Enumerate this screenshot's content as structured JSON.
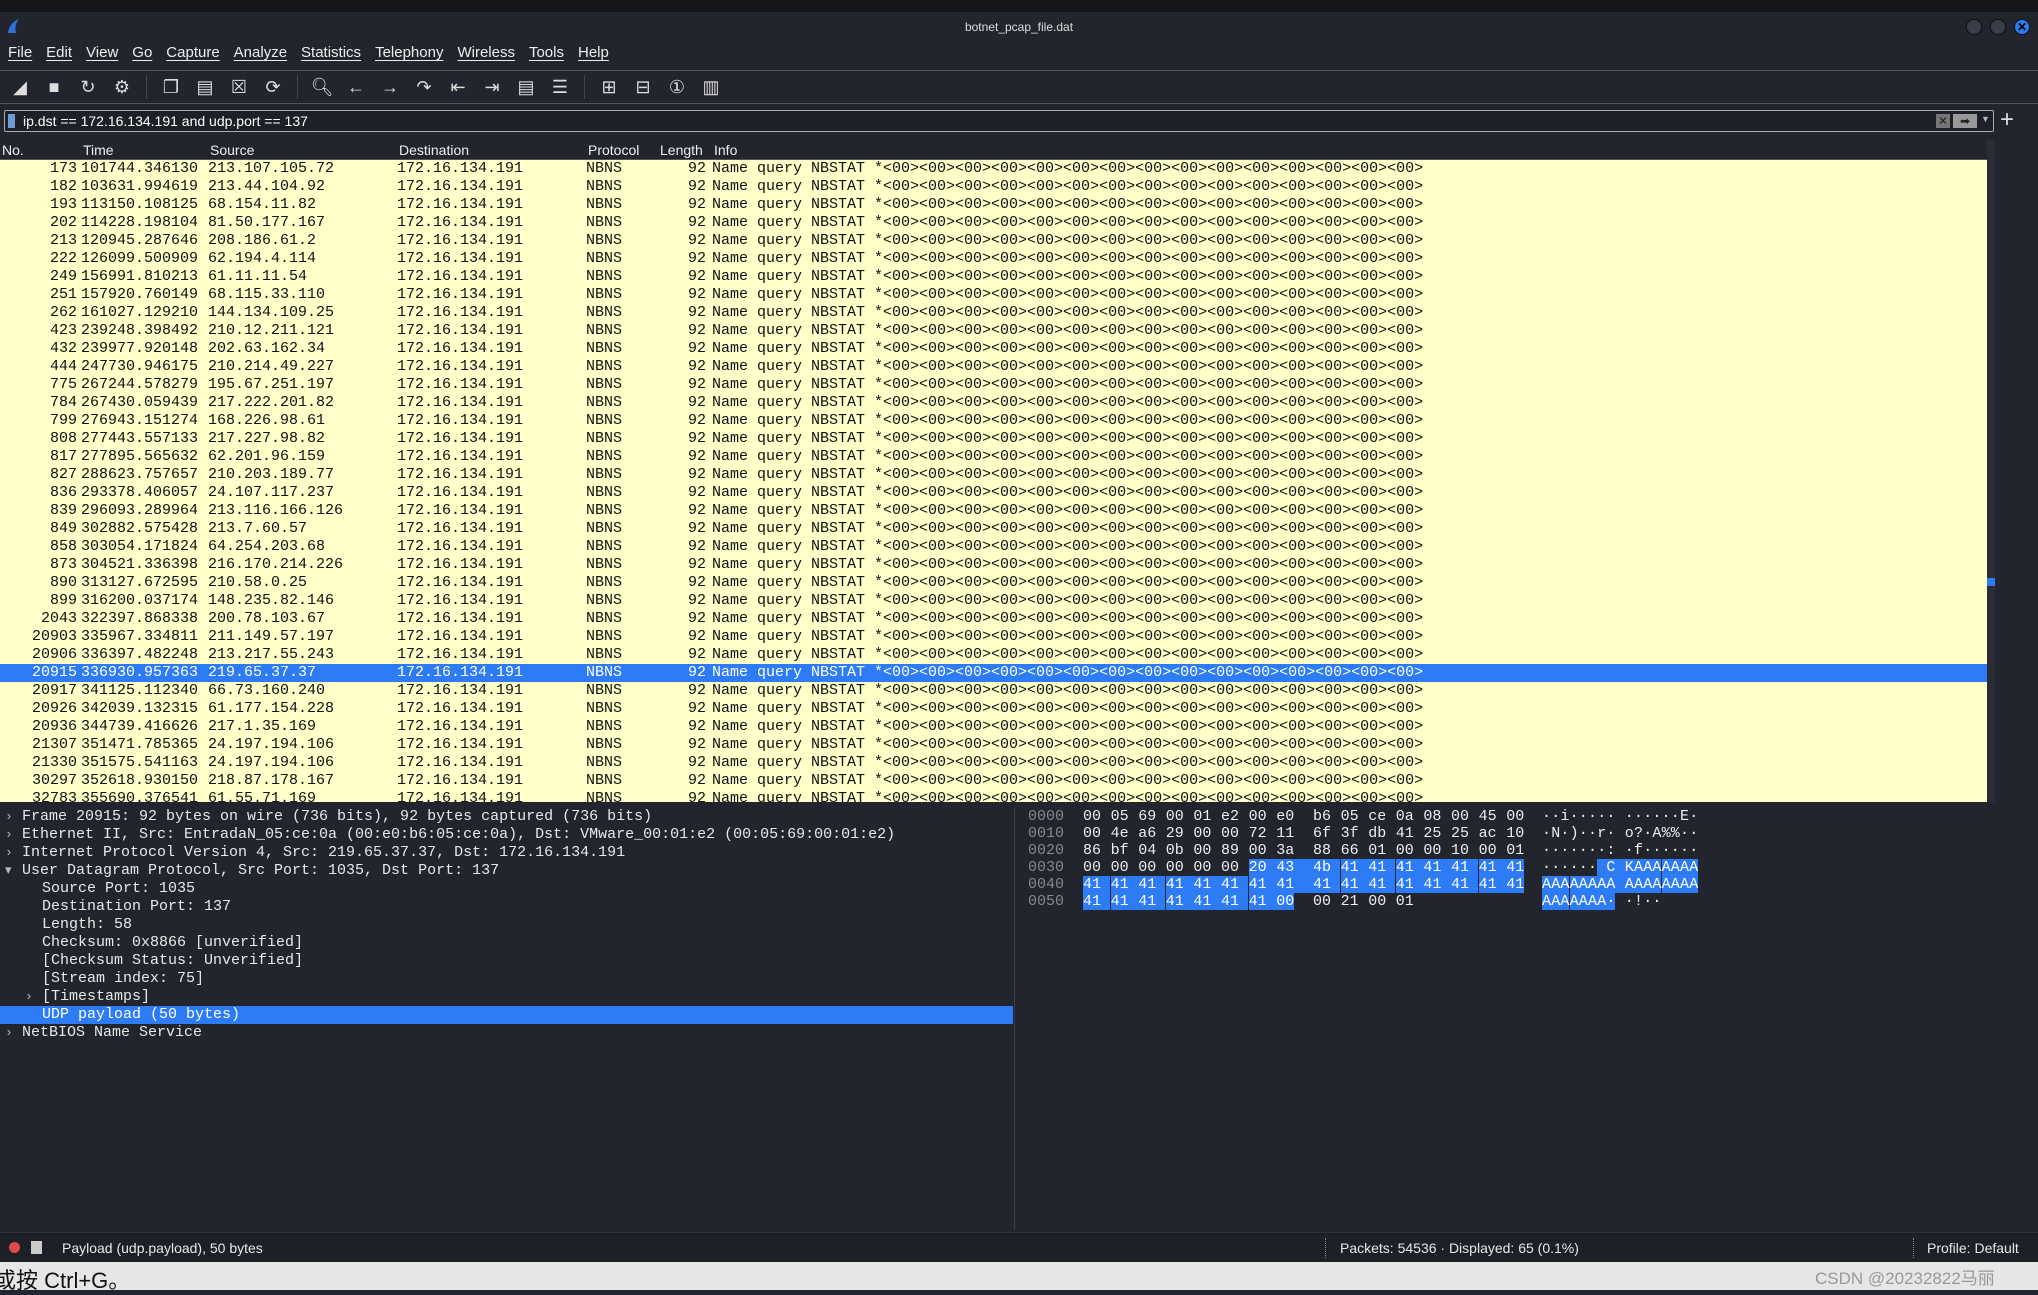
{
  "window": {
    "title": "botnet_pcap_file.dat"
  },
  "menu": [
    "File",
    "Edit",
    "View",
    "Go",
    "Capture",
    "Analyze",
    "Statistics",
    "Telephony",
    "Wireless",
    "Tools",
    "Help"
  ],
  "toolbar": [
    "shark-fin-start-icon",
    "stop-square-icon",
    "restart-fin-icon",
    "gear-options-icon",
    "open-file-icon",
    "save-file-icon",
    "close-file-icon",
    "reload-file-icon",
    "search-icon",
    "arrow-left-icon",
    "arrow-right-icon",
    "jump-icon",
    "first-packet-icon",
    "last-packet-icon",
    "autoscroll-icon",
    "colorize-icon",
    "zoom-in-icon",
    "zoom-out-icon",
    "normal-size-icon",
    "resize-columns-icon"
  ],
  "filter": {
    "value": "ip.dst == 172.16.134.191 and udp.port == 137"
  },
  "columns": [
    "No.",
    "Time",
    "Source",
    "Destination",
    "Protocol",
    "Length",
    "Info"
  ],
  "colors": {
    "list_bg": "#feffc9",
    "selected": "#2d7bf5",
    "background": "#23252e"
  },
  "packets": [
    [
      "173",
      "101744.346130",
      "213.107.105.72"
    ],
    [
      "182",
      "103631.994619",
      "213.44.104.92"
    ],
    [
      "193",
      "113150.108125",
      "68.154.11.82"
    ],
    [
      "202",
      "114228.198104",
      "81.50.177.167"
    ],
    [
      "213",
      "120945.287646",
      "208.186.61.2"
    ],
    [
      "222",
      "126099.500909",
      "62.194.4.114"
    ],
    [
      "249",
      "156991.810213",
      "61.11.11.54"
    ],
    [
      "251",
      "157920.760149",
      "68.115.33.110"
    ],
    [
      "262",
      "161027.129210",
      "144.134.109.25"
    ],
    [
      "423",
      "239248.398492",
      "210.12.211.121"
    ],
    [
      "432",
      "239977.920148",
      "202.63.162.34"
    ],
    [
      "444",
      "247730.946175",
      "210.214.49.227"
    ],
    [
      "775",
      "267244.578279",
      "195.67.251.197"
    ],
    [
      "784",
      "267430.059439",
      "217.222.201.82"
    ],
    [
      "799",
      "276943.151274",
      "168.226.98.61"
    ],
    [
      "808",
      "277443.557133",
      "217.227.98.82"
    ],
    [
      "817",
      "277895.565632",
      "62.201.96.159"
    ],
    [
      "827",
      "288623.757657",
      "210.203.189.77"
    ],
    [
      "836",
      "293378.406057",
      "24.107.117.237"
    ],
    [
      "839",
      "296093.289964",
      "213.116.166.126"
    ],
    [
      "849",
      "302882.575428",
      "213.7.60.57"
    ],
    [
      "858",
      "303054.171824",
      "64.254.203.68"
    ],
    [
      "873",
      "304521.336398",
      "216.170.214.226"
    ],
    [
      "890",
      "313127.672595",
      "210.58.0.25"
    ],
    [
      "899",
      "316200.037174",
      "148.235.82.146"
    ],
    [
      "2043",
      "322397.868338",
      "200.78.103.67"
    ],
    [
      "20903",
      "335967.334811",
      "211.149.57.197"
    ],
    [
      "20906",
      "336397.482248",
      "213.217.55.243"
    ],
    [
      "20915",
      "336930.957363",
      "219.65.37.37"
    ],
    [
      "20917",
      "341125.112340",
      "66.73.160.240"
    ],
    [
      "20926",
      "342039.132315",
      "61.177.154.228"
    ],
    [
      "20936",
      "344739.416626",
      "217.1.35.169"
    ],
    [
      "21307",
      "351471.785365",
      "24.197.194.106"
    ],
    [
      "21330",
      "351575.541163",
      "24.197.194.106"
    ],
    [
      "30297",
      "352618.930150",
      "218.87.178.167"
    ],
    [
      "32783",
      "355690.376541",
      "61.55.71.169"
    ]
  ],
  "packet_common": {
    "destination": "172.16.134.191",
    "protocol": "NBNS",
    "length": "92",
    "info": "Name query NBSTAT *<00><00><00><00><00><00><00><00><00><00><00><00><00><00><00>"
  },
  "selected_packet": "20915",
  "details": [
    {
      "text": "Frame 20915: 92 bytes on wire (736 bits), 92 bytes captured (736 bits)",
      "level": 0,
      "arrow": "collapsed"
    },
    {
      "text": "Ethernet II, Src: EntradaN_05:ce:0a (00:e0:b6:05:ce:0a), Dst: VMware_00:01:e2 (00:05:69:00:01:e2)",
      "level": 0,
      "arrow": "collapsed"
    },
    {
      "text": "Internet Protocol Version 4, Src: 219.65.37.37, Dst: 172.16.134.191",
      "level": 0,
      "arrow": "collapsed"
    },
    {
      "text": "User Datagram Protocol, Src Port: 1035, Dst Port: 137",
      "level": 0,
      "arrow": "expanded"
    },
    {
      "text": "Source Port: 1035",
      "level": 1
    },
    {
      "text": "Destination Port: 137",
      "level": 1
    },
    {
      "text": "Length: 58",
      "level": 1
    },
    {
      "text": "Checksum: 0x8866 [unverified]",
      "level": 1
    },
    {
      "text": "[Checksum Status: Unverified]",
      "level": 1
    },
    {
      "text": "[Stream index: 75]",
      "level": 1
    },
    {
      "text": "[Timestamps]",
      "level": 1,
      "arrow": "collapsed"
    },
    {
      "text": "UDP payload (50 bytes)",
      "level": 1,
      "selected": true
    },
    {
      "text": "NetBIOS Name Service",
      "level": 0,
      "arrow": "collapsed"
    }
  ],
  "hex": [
    {
      "offset": "0000",
      "bytes": [
        "00",
        "05",
        "69",
        "00",
        "01",
        "e2",
        "00",
        "e0",
        "b6",
        "05",
        "ce",
        "0a",
        "08",
        "00",
        "45",
        "00"
      ]
    },
    {
      "offset": "0010",
      "bytes": [
        "00",
        "4e",
        "a6",
        "29",
        "00",
        "00",
        "72",
        "11",
        "6f",
        "3f",
        "db",
        "41",
        "25",
        "25",
        "ac",
        "10"
      ]
    },
    {
      "offset": "0020",
      "bytes": [
        "86",
        "bf",
        "04",
        "0b",
        "00",
        "89",
        "00",
        "3a",
        "88",
        "66",
        "01",
        "00",
        "00",
        "10",
        "00",
        "01"
      ]
    },
    {
      "offset": "0030",
      "bytes": [
        "00",
        "00",
        "00",
        "00",
        "00",
        "00",
        "20",
        "43",
        "4b",
        "41",
        "41",
        "41",
        "41",
        "41",
        "41",
        "41"
      ]
    },
    {
      "offset": "0040",
      "bytes": [
        "41",
        "41",
        "41",
        "41",
        "41",
        "41",
        "41",
        "41",
        "41",
        "41",
        "41",
        "41",
        "41",
        "41",
        "41",
        "41"
      ]
    },
    {
      "offset": "0050",
      "bytes": [
        "41",
        "41",
        "41",
        "41",
        "41",
        "41",
        "41",
        "00",
        "00",
        "21",
        "00",
        "01"
      ]
    }
  ],
  "hex_highlight": {
    "first_byte": 54,
    "last_byte": 87
  },
  "status": {
    "message": "Payload (udp.payload), 50 bytes",
    "packets": "Packets: 54536 · Displayed: 65 (0.1%)",
    "profile": "Profile: Default"
  },
  "bottom": {
    "hint": "或按 Ctrl+G。",
    "watermark": "CSDN @20232822马丽"
  }
}
